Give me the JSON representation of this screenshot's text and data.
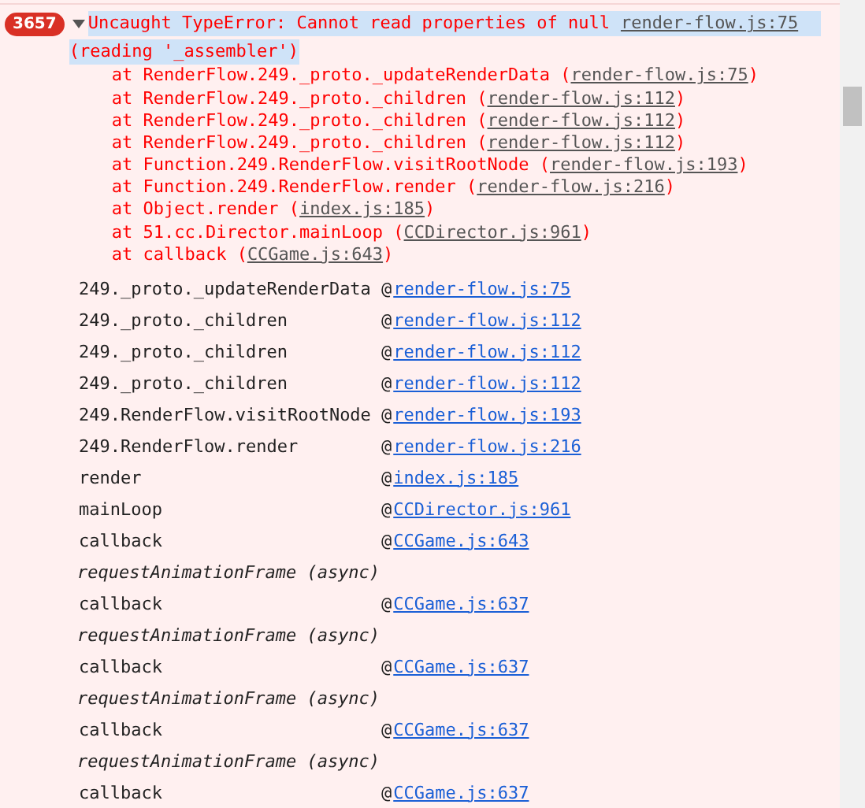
{
  "error": {
    "count": "3657",
    "expanded": true,
    "selected": true,
    "text": "Uncaught TypeError: Cannot read properties of null",
    "source": "render-flow.js:75",
    "text_continued": "(reading '_assembler')"
  },
  "stack_lines": [
    {
      "prefix": "at RenderFlow.249._proto._updateRenderData (",
      "link": "render-flow.js:75",
      "suffix": ")"
    },
    {
      "prefix": "at RenderFlow.249._proto._children (",
      "link": "render-flow.js:112",
      "suffix": ")"
    },
    {
      "prefix": "at RenderFlow.249._proto._children (",
      "link": "render-flow.js:112",
      "suffix": ")"
    },
    {
      "prefix": "at RenderFlow.249._proto._children (",
      "link": "render-flow.js:112",
      "suffix": ")"
    },
    {
      "prefix": "at Function.249.RenderFlow.visitRootNode (",
      "link": "render-flow.js:193",
      "suffix": ")"
    },
    {
      "prefix": "at Function.249.RenderFlow.render (",
      "link": "render-flow.js:216",
      "suffix": ")"
    },
    {
      "prefix": "at Object.render (",
      "link": "index.js:185",
      "suffix": ")"
    },
    {
      "prefix": "at 51.cc.Director.mainLoop (",
      "link": "CCDirector.js:961",
      "suffix": ")"
    },
    {
      "prefix": "at callback (",
      "link": "CCGame.js:643",
      "suffix": ")"
    }
  ],
  "frames": [
    {
      "kind": "frame",
      "function": "249._proto._updateRenderData",
      "at": "@",
      "link": "render-flow.js:75"
    },
    {
      "kind": "frame",
      "function": "249._proto._children",
      "at": "@",
      "link": "render-flow.js:112"
    },
    {
      "kind": "frame",
      "function": "249._proto._children",
      "at": "@",
      "link": "render-flow.js:112"
    },
    {
      "kind": "frame",
      "function": "249._proto._children",
      "at": "@",
      "link": "render-flow.js:112"
    },
    {
      "kind": "frame",
      "function": "249.RenderFlow.visitRootNode",
      "at": "@",
      "link": "render-flow.js:193"
    },
    {
      "kind": "frame",
      "function": "249.RenderFlow.render",
      "at": "@",
      "link": "render-flow.js:216"
    },
    {
      "kind": "frame",
      "function": "render",
      "at": "@",
      "link": "index.js:185"
    },
    {
      "kind": "frame",
      "function": "mainLoop",
      "at": "@",
      "link": "CCDirector.js:961"
    },
    {
      "kind": "frame",
      "function": "callback",
      "at": "@",
      "link": "CCGame.js:643"
    },
    {
      "kind": "async",
      "label": "requestAnimationFrame (async)"
    },
    {
      "kind": "frame",
      "function": "callback",
      "at": "@",
      "link": "CCGame.js:637"
    },
    {
      "kind": "async",
      "label": "requestAnimationFrame (async)"
    },
    {
      "kind": "frame",
      "function": "callback",
      "at": "@",
      "link": "CCGame.js:637"
    },
    {
      "kind": "async",
      "label": "requestAnimationFrame (async)"
    },
    {
      "kind": "frame",
      "function": "callback",
      "at": "@",
      "link": "CCGame.js:637"
    },
    {
      "kind": "async",
      "label": "requestAnimationFrame (async)"
    },
    {
      "kind": "frame",
      "function": "callback",
      "at": "@",
      "link": "CCGame.js:637"
    }
  ]
}
